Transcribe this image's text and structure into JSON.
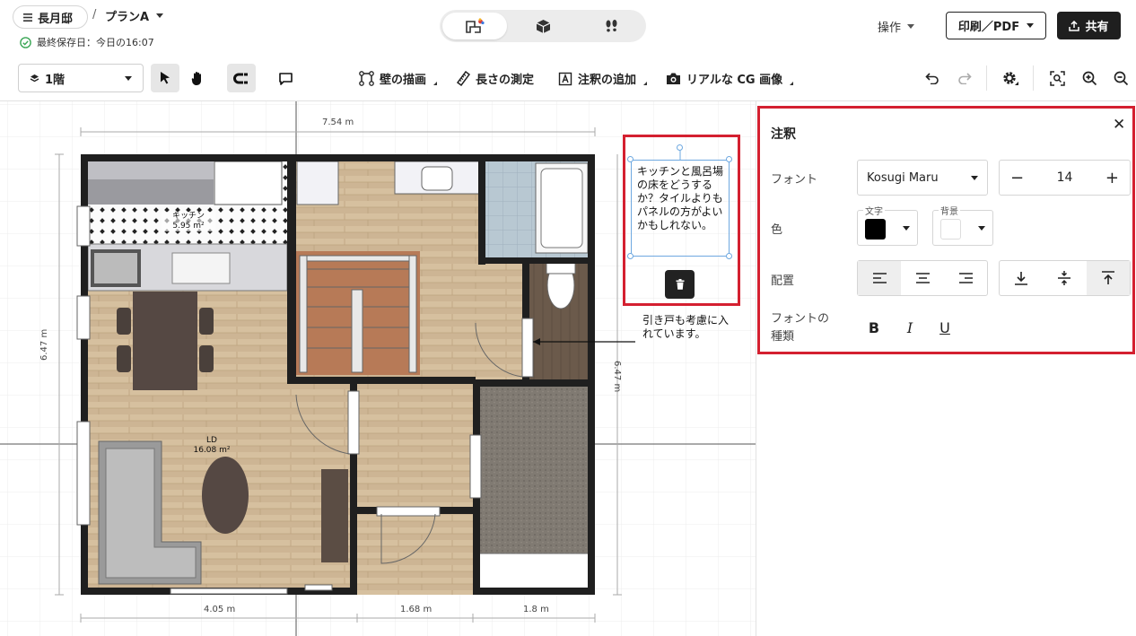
{
  "header": {
    "project_name": "長月邸",
    "separator": "/",
    "plan_name": "プランA",
    "saved_text": "最終保存日：今日の16:07",
    "ops_label": "操作",
    "print_label": "印刷／PDF",
    "share_label": "共有"
  },
  "toolbar": {
    "floor": "1階",
    "draw_walls": "壁の描画",
    "measure": "長さの測定",
    "add_annotation": "注釈の追加",
    "cg_image": "リアルな CG 画像"
  },
  "plan": {
    "dim_top": "7.54 m",
    "dim_left": "6.47 m",
    "dim_right": "6.47 m",
    "dim_bottom": [
      "4.05 m",
      "1.68 m",
      "1.8 m"
    ],
    "kitchen_label": "キッチン",
    "kitchen_area": "5.95 m²",
    "ld_label": "LD",
    "ld_area": "16.08 m²",
    "note_text": "キッチンと風呂場の床をどうするか？タイルよりもパネルの方がよいかもしれない。",
    "door_note": "引き戸も考慮に入れています。"
  },
  "panel": {
    "title": "注釈",
    "font_label": "フォント",
    "font_value": "Kosugi Maru",
    "size_value": "14",
    "color_label": "色",
    "text_color_legend": "文字",
    "bg_color_legend": "背景",
    "text_color": "#000000",
    "bg_color": "#ffffff",
    "align_label": "配置",
    "style_label_1": "フォントの",
    "style_label_2": "種類",
    "bold": "B",
    "italic": "I",
    "underline": "U"
  },
  "colors": {
    "accent_red": "#d42030",
    "selection_blue": "#6ea8e0"
  }
}
